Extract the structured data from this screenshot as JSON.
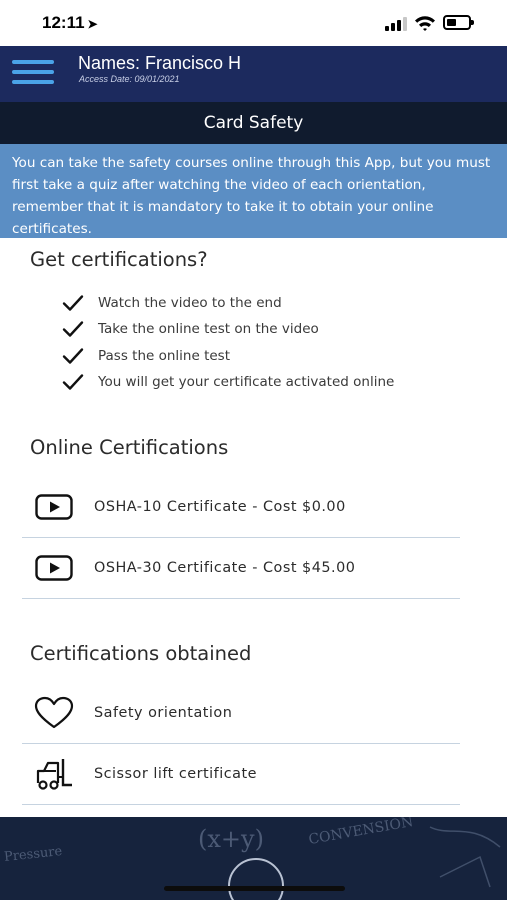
{
  "status_bar": {
    "time": "12:11",
    "location_glyph": "➤"
  },
  "header": {
    "user_name": "Names: Francisco H",
    "access_date": "Access Date: 09/01/2021"
  },
  "title": "Card Safety",
  "info_banner": "You can take the safety courses online through this App, but you must first take a quiz after watching the video of each orientation, remember that it is mandatory to take it to obtain your online certificates.",
  "get_certifications": {
    "heading": "Get certifications?",
    "steps": [
      "Watch the video to the end",
      "Take the online test on the video",
      "Pass the online test",
      "You will get your certificate activated online"
    ]
  },
  "online_certifications": {
    "heading": "Online Certifications",
    "items": [
      {
        "label": "OSHA-10 Certificate - Cost $0.00",
        "icon": "play-icon"
      },
      {
        "label": "OSHA-30 Certificate - Cost $45.00",
        "icon": "play-icon"
      }
    ]
  },
  "certifications_obtained": {
    "heading": "Certifications obtained",
    "items": [
      {
        "label": "Safety orientation",
        "icon": "heart-icon"
      },
      {
        "label": "Scissor lift certificate",
        "icon": "forklift-icon"
      }
    ]
  },
  "footer": {
    "chalk_texts": [
      "(x+y)",
      "CONVENSION",
      "Pressure"
    ]
  },
  "colors": {
    "header_bg": "#1c2a5e",
    "title_bar_bg": "#101b2e",
    "banner_bg": "#5b8ec4",
    "menu_accent": "#4aa3e8",
    "divider": "#c6d3e0"
  }
}
